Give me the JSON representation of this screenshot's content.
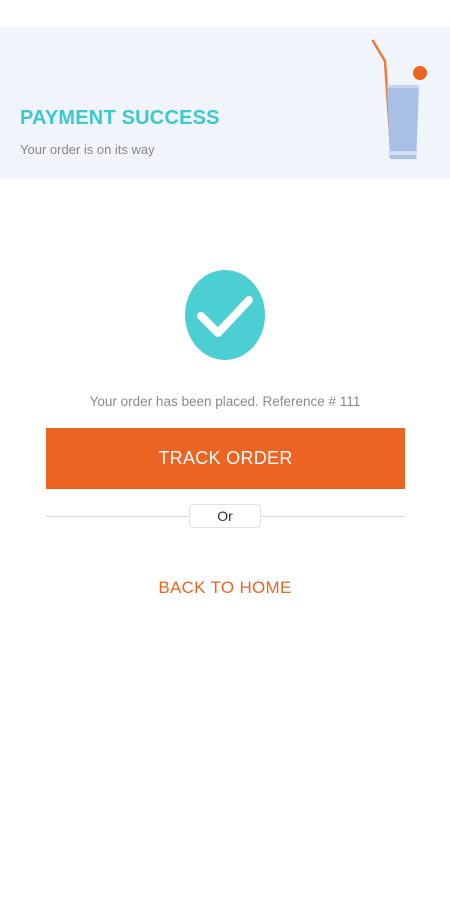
{
  "header": {
    "title": "PAYMENT SUCCESS",
    "subtitle": "Your order is on its way",
    "illustration": "drink-glass-icon"
  },
  "confirmation": {
    "icon": "check-circle-icon",
    "message": "Your order has been placed. Reference # 111"
  },
  "actions": {
    "track_label": "TRACK ORDER",
    "divider_label": "Or",
    "home_label": "BACK TO HOME"
  },
  "colors": {
    "accent_teal": "#3cc8cf",
    "accent_orange": "#ec6422",
    "header_bg": "#f1f4fb"
  }
}
